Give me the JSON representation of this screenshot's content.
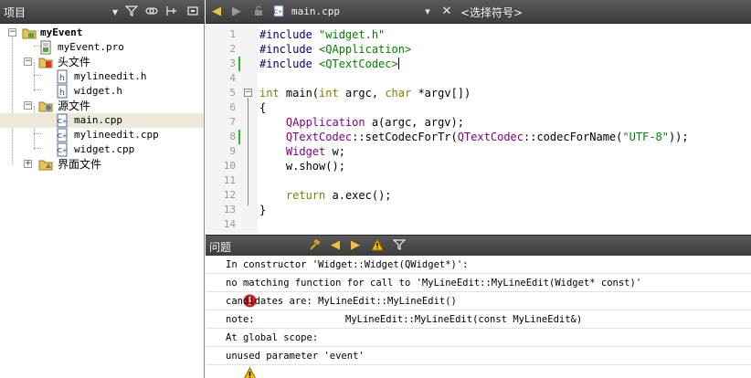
{
  "project_panel": {
    "title": "项目",
    "tree": [
      {
        "label": "myEvent",
        "icon": "project-folder-icon"
      },
      {
        "label": "myEvent.pro",
        "icon": "pro-file-icon"
      },
      {
        "label": "头文件",
        "icon": "header-folder-icon"
      },
      {
        "label": "mylineedit.h",
        "icon": "header-file-icon"
      },
      {
        "label": "widget.h",
        "icon": "header-file-icon"
      },
      {
        "label": "源文件",
        "icon": "source-folder-icon"
      },
      {
        "label": "main.cpp",
        "icon": "cpp-file-icon"
      },
      {
        "label": "mylineedit.cpp",
        "icon": "cpp-file-icon"
      },
      {
        "label": "widget.cpp",
        "icon": "cpp-file-icon"
      },
      {
        "label": "界面文件",
        "icon": "forms-folder-icon"
      }
    ]
  },
  "editor": {
    "current_file": "main.cpp",
    "symbols_placeholder": "<选择符号>",
    "line_numbers": [
      "1",
      "2",
      "3",
      "4",
      "5",
      "6",
      "7",
      "8",
      "9",
      "10",
      "11",
      "12",
      "13",
      "14"
    ],
    "lines": [
      [
        {
          "t": "#include ",
          "c": "pp"
        },
        {
          "t": "\"widget.h\"",
          "c": "str"
        }
      ],
      [
        {
          "t": "#include ",
          "c": "pp"
        },
        {
          "t": "<QApplication>",
          "c": "str"
        }
      ],
      [
        {
          "t": "#include ",
          "c": "pp"
        },
        {
          "t": "<QTextCodec>",
          "c": "str"
        }
      ],
      [],
      [
        {
          "t": "int",
          "c": "kw"
        },
        {
          "t": " main(",
          "c": ""
        },
        {
          "t": "int",
          "c": "kw"
        },
        {
          "t": " argc, ",
          "c": ""
        },
        {
          "t": "char",
          "c": "kw"
        },
        {
          "t": " *argv[])",
          "c": ""
        }
      ],
      [
        {
          "t": "{",
          "c": ""
        }
      ],
      [
        {
          "t": "    ",
          "c": ""
        },
        {
          "t": "QApplication",
          "c": "cls"
        },
        {
          "t": " a(argc, argv);",
          "c": ""
        }
      ],
      [
        {
          "t": "    ",
          "c": ""
        },
        {
          "t": "QTextCodec",
          "c": "cls"
        },
        {
          "t": "::setCodecForTr(",
          "c": ""
        },
        {
          "t": "QTextCodec",
          "c": "cls"
        },
        {
          "t": "::codecForName(",
          "c": ""
        },
        {
          "t": "\"UTF-8\"",
          "c": "str"
        },
        {
          "t": "));",
          "c": ""
        }
      ],
      [
        {
          "t": "    ",
          "c": ""
        },
        {
          "t": "Widget",
          "c": "cls"
        },
        {
          "t": " w;",
          "c": ""
        }
      ],
      [
        {
          "t": "    w.show();",
          "c": ""
        }
      ],
      [],
      [
        {
          "t": "    ",
          "c": ""
        },
        {
          "t": "return",
          "c": "kw"
        },
        {
          "t": " a.exec();",
          "c": ""
        }
      ],
      [
        {
          "t": "}",
          "c": ""
        }
      ],
      []
    ]
  },
  "issues_panel": {
    "title": "问题",
    "items": [
      {
        "type": "none",
        "text": "In constructor 'Widget::Widget(QWidget*)':"
      },
      {
        "type": "error",
        "text": "no matching function for call to 'MyLineEdit::MyLineEdit(Widget* const)'"
      },
      {
        "type": "none",
        "text": "candidates are: MyLineEdit::MyLineEdit()"
      },
      {
        "type": "none",
        "text": "note:",
        "detail": "MyLineEdit::MyLineEdit(const MyLineEdit&)"
      },
      {
        "type": "none",
        "text": "At global scope:"
      },
      {
        "type": "warning",
        "text": "unused parameter 'event'"
      }
    ]
  },
  "colors": {
    "toolbar_bg": "#4a4a4a",
    "keyword": "#808000",
    "preprocessor": "#000080",
    "string": "#008000",
    "class": "#800080",
    "changed_line_marker": "#2db52d",
    "error": "#d81e1e",
    "warning": "#f2c200"
  }
}
